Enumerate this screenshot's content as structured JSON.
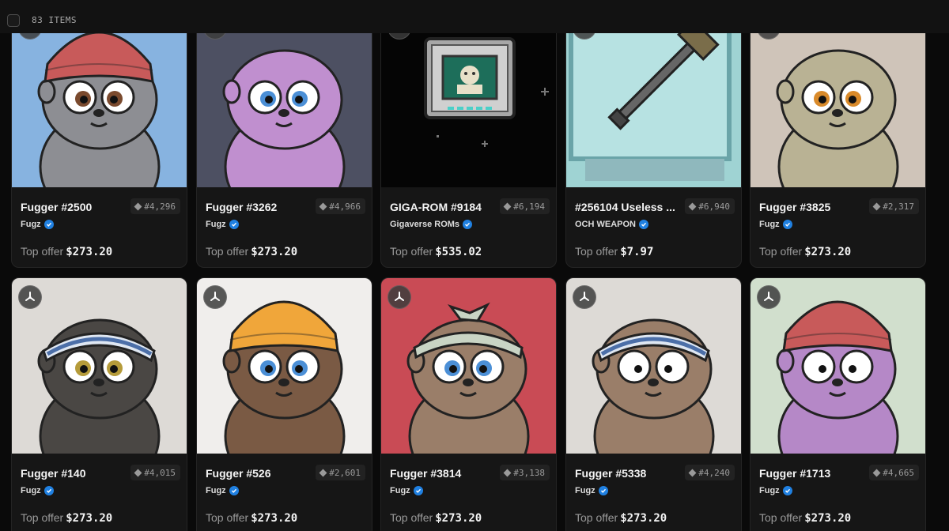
{
  "header": {
    "items_count": "83 ITEMS"
  },
  "offer_label": "Top offer",
  "cards": [
    {
      "title": "Fugger #2500",
      "rank": "#4,296",
      "collection": "Fugz",
      "top_offer": "$273.20",
      "bg": "#87b3e0",
      "art": "fugger-red-beanie"
    },
    {
      "title": "Fugger #3262",
      "rank": "#4,966",
      "collection": "Fugz",
      "top_offer": "$273.20",
      "bg": "#4d5062",
      "art": "fugger-purple"
    },
    {
      "title": "GIGA-ROM #9184",
      "rank": "#6,194",
      "collection": "Gigaverse ROMs",
      "top_offer": "$535.02",
      "bg": "#050505",
      "art": "giga-rom-cartridge"
    },
    {
      "title": "#256104 Useless ...",
      "rank": "#6,940",
      "collection": "OCH WEAPON",
      "top_offer": "$7.97",
      "bg": "#9fd3d3",
      "art": "pixel-weapon"
    },
    {
      "title": "Fugger #3825",
      "rank": "#2,317",
      "collection": "Fugz",
      "top_offer": "$273.20",
      "bg": "#cfc4b9",
      "art": "fugger-beige"
    },
    {
      "title": "Fugger #140",
      "rank": "#4,015",
      "collection": "Fugz",
      "top_offer": "$273.20",
      "bg": "#dddad6",
      "art": "fugger-black-headband"
    },
    {
      "title": "Fugger #526",
      "rank": "#2,601",
      "collection": "Fugz",
      "top_offer": "$273.20",
      "bg": "#f0eeec",
      "art": "fugger-yellow-beanie"
    },
    {
      "title": "Fugger #3814",
      "rank": "#3,138",
      "collection": "Fugz",
      "top_offer": "$273.20",
      "bg": "#c94b55",
      "art": "fugger-bandana"
    },
    {
      "title": "Fugger #5338",
      "rank": "#4,240",
      "collection": "Fugz",
      "top_offer": "$273.20",
      "bg": "#dddad6",
      "art": "fugger-headband"
    },
    {
      "title": "Fugger #1713",
      "rank": "#4,665",
      "collection": "Fugz",
      "top_offer": "$273.20",
      "bg": "#d1dfcd",
      "art": "fugger-purple-beanie"
    }
  ]
}
